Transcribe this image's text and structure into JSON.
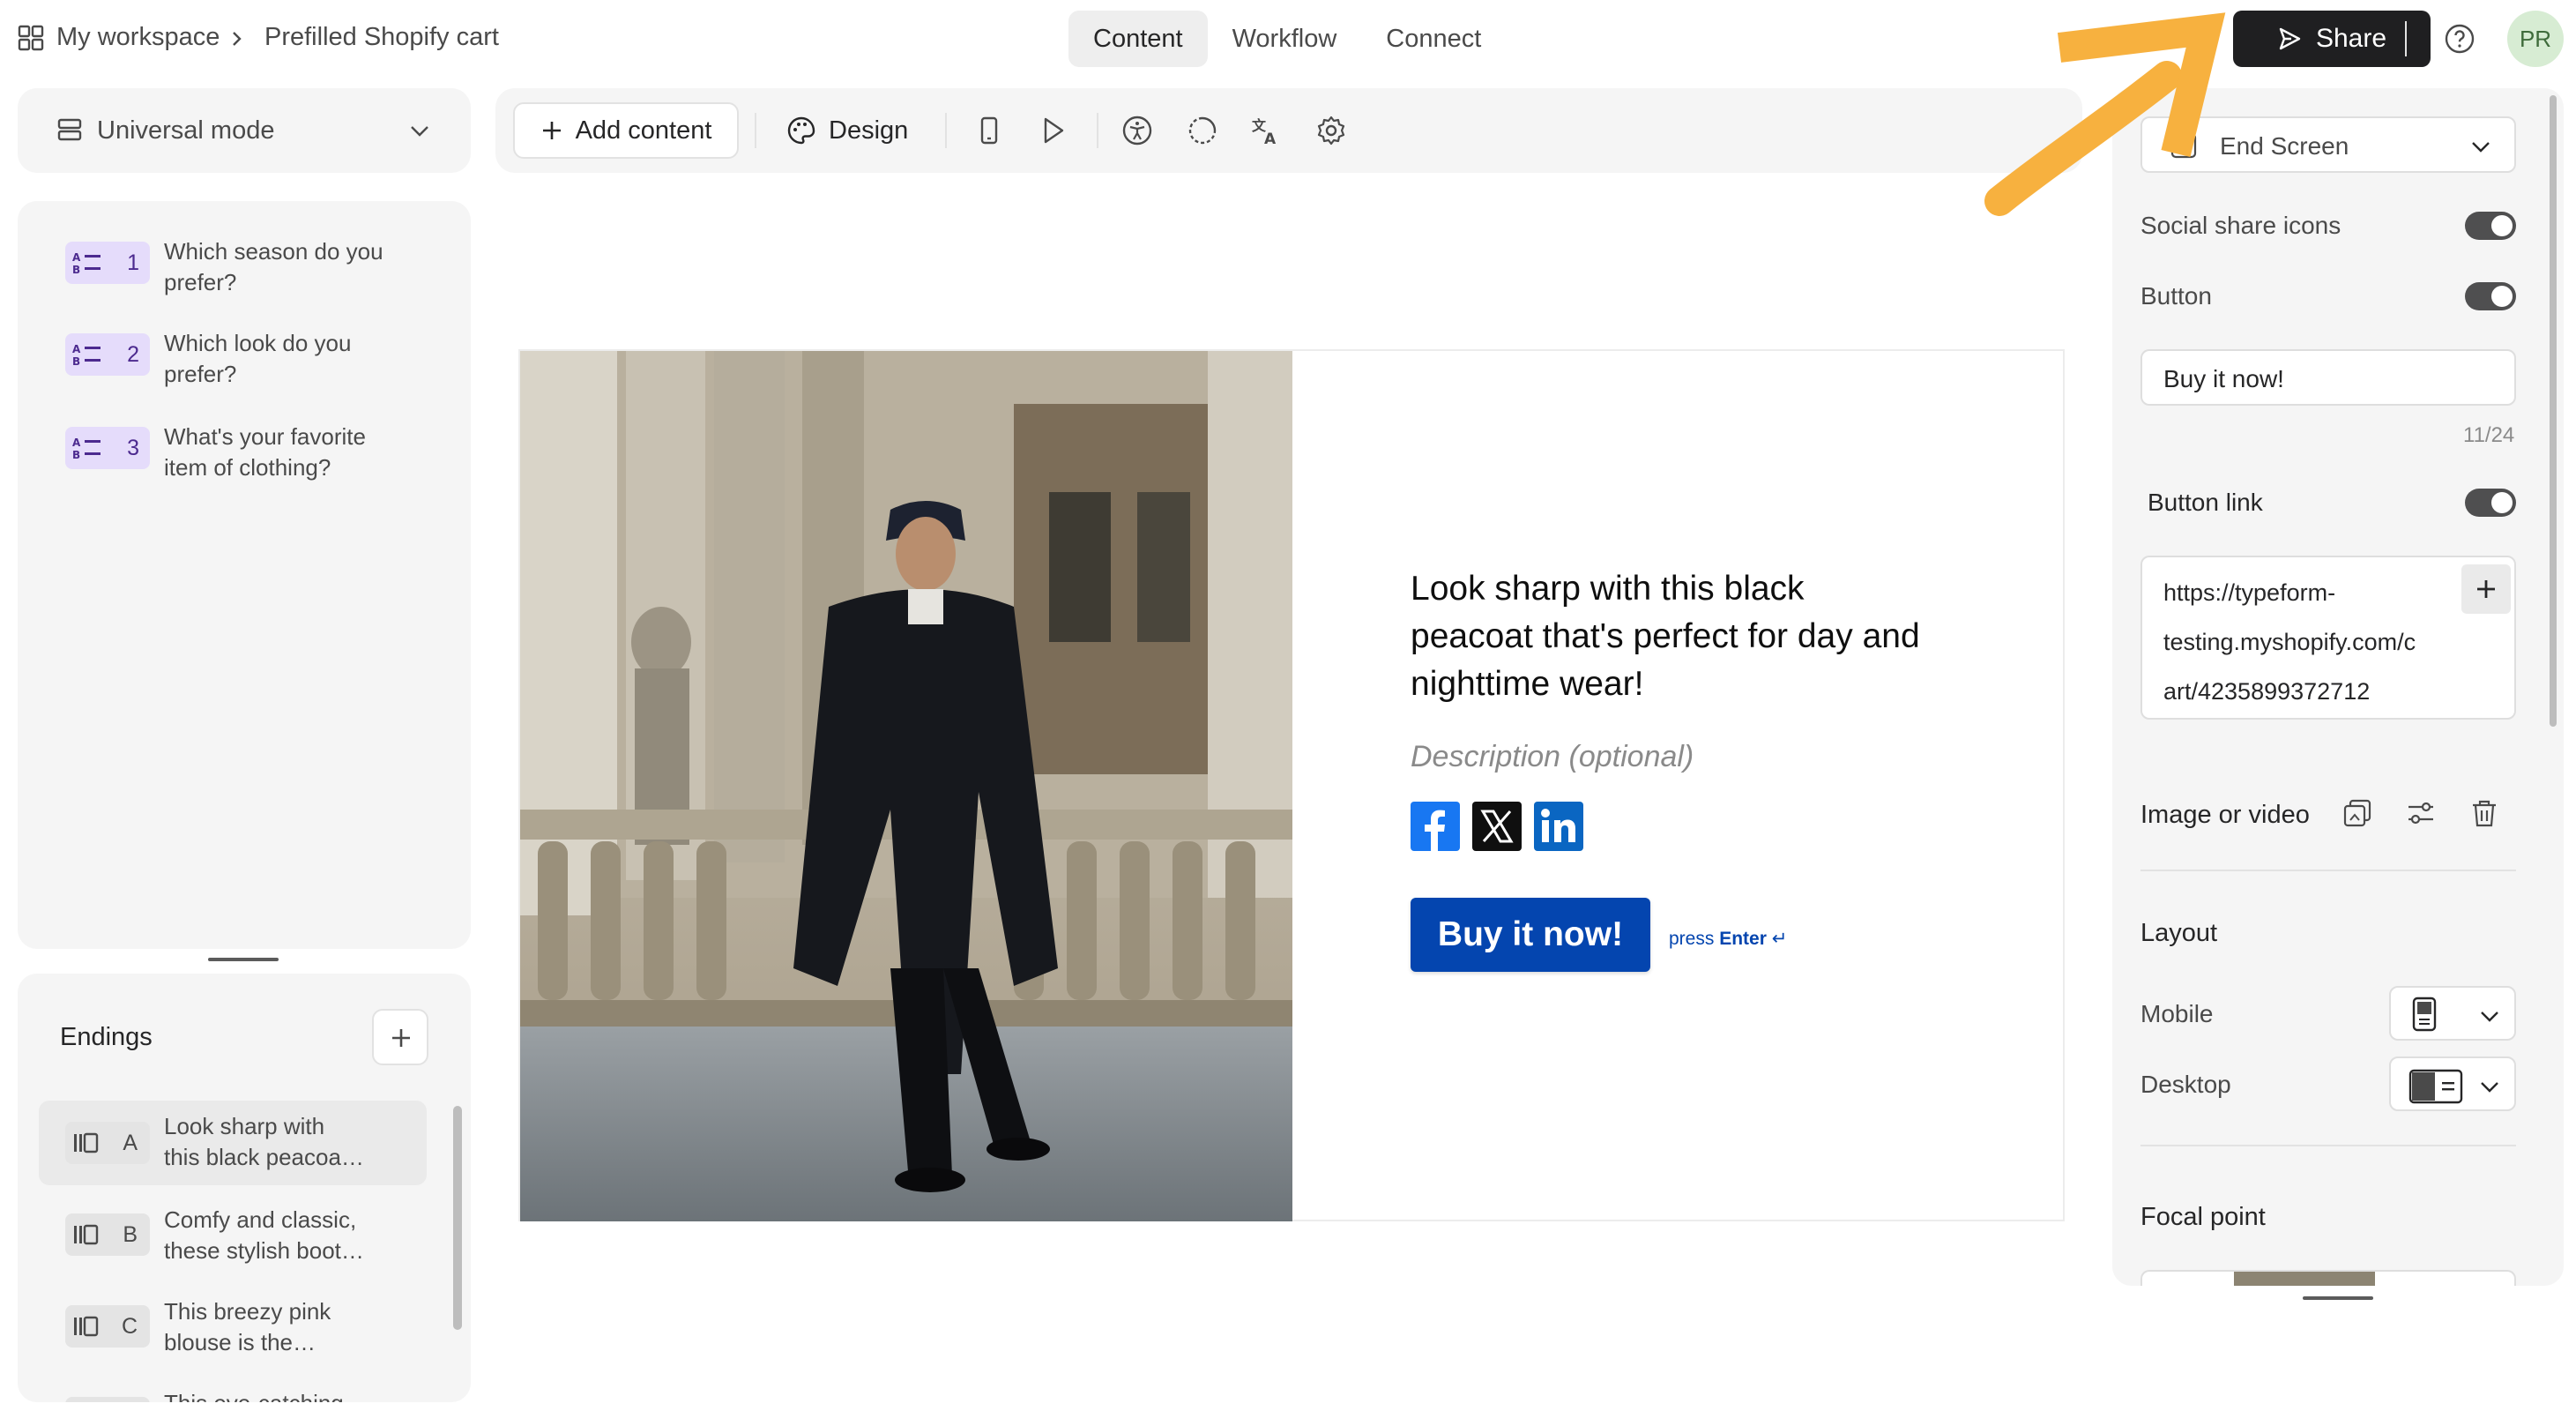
{
  "topbar": {
    "workspace": "My workspace",
    "form_title": "Prefilled Shopify cart",
    "tabs": [
      {
        "label": "Content",
        "active": true
      },
      {
        "label": "Workflow",
        "active": false
      },
      {
        "label": "Connect",
        "active": false
      }
    ],
    "share_label": "Share",
    "avatar_initials": "PR"
  },
  "sidebar": {
    "mode_label": "Universal mode",
    "questions": [
      {
        "number": "1",
        "line1": "Which season do you",
        "line2": "prefer?"
      },
      {
        "number": "2",
        "line1": "Which look do you",
        "line2": "prefer?"
      },
      {
        "number": "3",
        "line1": "What's your favorite",
        "line2": "item of clothing?"
      }
    ],
    "endings_title": "Endings",
    "endings": [
      {
        "letter": "A",
        "line1": "Look sharp with",
        "line2": "this black peacoa…",
        "selected": true
      },
      {
        "letter": "B",
        "line1": "Comfy and classic,",
        "line2": "these stylish boot…",
        "selected": false
      },
      {
        "letter": "C",
        "line1": "This breezy pink",
        "line2": "blouse is the…",
        "selected": false
      },
      {
        "letter": "D",
        "line1": "This eye-catching",
        "line2": "",
        "selected": false
      }
    ]
  },
  "toolbar": {
    "add_content": "Add content",
    "design": "Design"
  },
  "canvas": {
    "headline_line1": "Look sharp with this black",
    "headline_line2": "peacoat that's perfect for day and",
    "headline_line3": "nighttime wear!",
    "description_placeholder": "Description (optional)",
    "button_label": "Buy it now!",
    "press": "press",
    "enter": "Enter",
    "enter_glyph": "↵",
    "social": [
      "facebook",
      "x",
      "linkedin"
    ]
  },
  "right_panel": {
    "screen_type": "End Screen",
    "social_share_label": "Social share icons",
    "social_share_on": true,
    "button_label": "Button",
    "button_on": true,
    "button_text_value": "Buy it now!",
    "button_text_counter": "11/24",
    "button_link_label": "Button link",
    "button_link_on": true,
    "link_line1": "https://typeform-",
    "link_line2": "testing.myshopify.com/c",
    "link_line3": "art/4235899372712",
    "image_or_video": "Image or video",
    "layout_title": "Layout",
    "mobile_label": "Mobile",
    "desktop_label": "Desktop",
    "focal_point_title": "Focal point"
  },
  "colors": {
    "accent_button": "#0445af",
    "share_button": "#1f1f21",
    "annotation_arrow": "#f7b13f",
    "question_badge": "#e5dcfb"
  }
}
